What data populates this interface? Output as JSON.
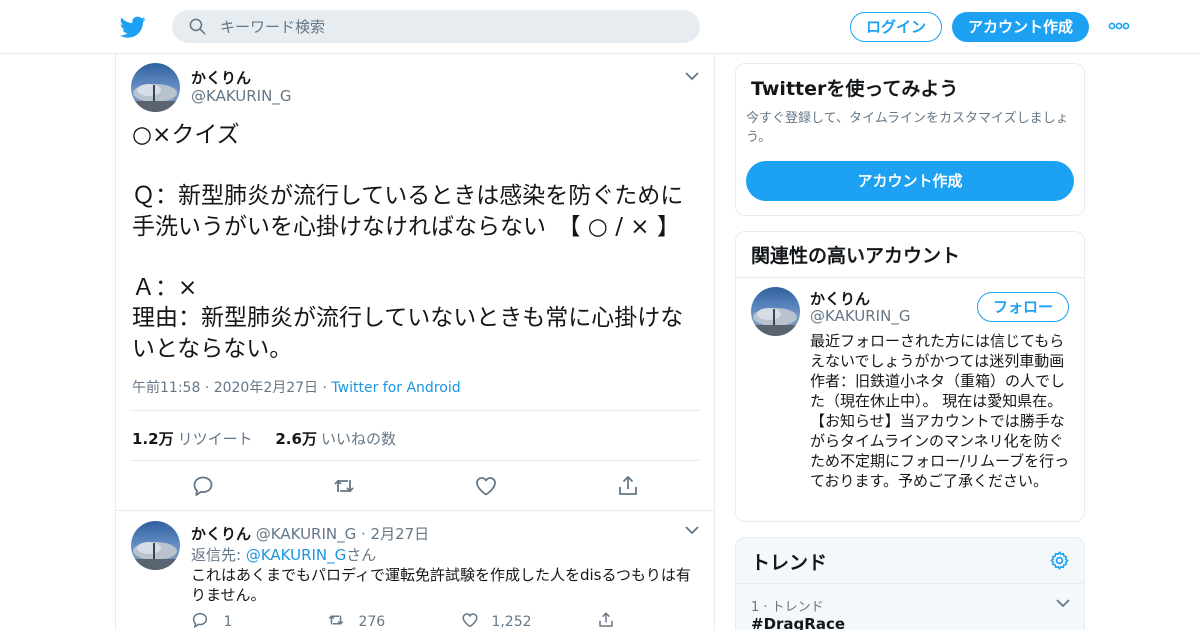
{
  "topbar": {
    "logo_icon": "twitter-bird-icon",
    "search_placeholder": "キーワード検索",
    "login_label": "ログイン",
    "signup_label": "アカウント作成",
    "more_icon": "more-dots-icon"
  },
  "tweet": {
    "name": "かくりん",
    "handle": "@KAKURIN_G",
    "body": "○×クイズ\n\nＱ：新型肺炎が流行しているときは感染を防ぐために手洗いうがいを心掛けなければならない　【 ○ / × 】\n\nＡ：×\n理由：新型肺炎が流行していないときも常に心掛けないとならない。",
    "time": "午前11:58 · 2020年2月27日",
    "via": "Twitter for Android",
    "retweets_count": "1.2万",
    "retweets_label": "リツイート",
    "likes_count": "2.6万",
    "likes_label": "いいねの数"
  },
  "reply": {
    "name": "かくりん",
    "handle": "@KAKURIN_G",
    "date": "· 2月27日",
    "reply_to_prefix": "返信先: ",
    "reply_to_mention": "@KAKURIN_G",
    "reply_to_suffix": "さん",
    "text": "これはあくまでもパロディで運転免許試験を作成した人をdisるつもりは有りません。",
    "replies": "1",
    "retweets": "276",
    "likes": "1,252"
  },
  "sidebar": {
    "try_card": {
      "title": "Twitterを使ってみよう",
      "desc": "今すぐ登録して、タイムラインをカスタマイズしましょう。",
      "button": "アカウント作成"
    },
    "related_card": {
      "title": "関連性の高いアカウント",
      "name": "かくりん",
      "handle": "@KAKURIN_G",
      "follow_label": "フォロー",
      "bio": "最近フォローされた方には信じてもらえないでしょうがかつては迷列車動画作者：旧鉄道小ネタ（重箱）の人でした（現在休止中）。 現在は愛知県在。【お知らせ】当アカウントでは勝手ながらタイムラインのマンネリ化を防ぐため不定期にフォロー/リムーブを行っております。予めご了承ください。"
    },
    "trends_card": {
      "title": "トレンド",
      "rank_label": "1 · トレンド",
      "tag": "#DragRace"
    }
  },
  "colors": {
    "accent": "#1da1f2",
    "link": "#1b95e0",
    "muted": "#657786",
    "border": "#e6ecf0"
  }
}
